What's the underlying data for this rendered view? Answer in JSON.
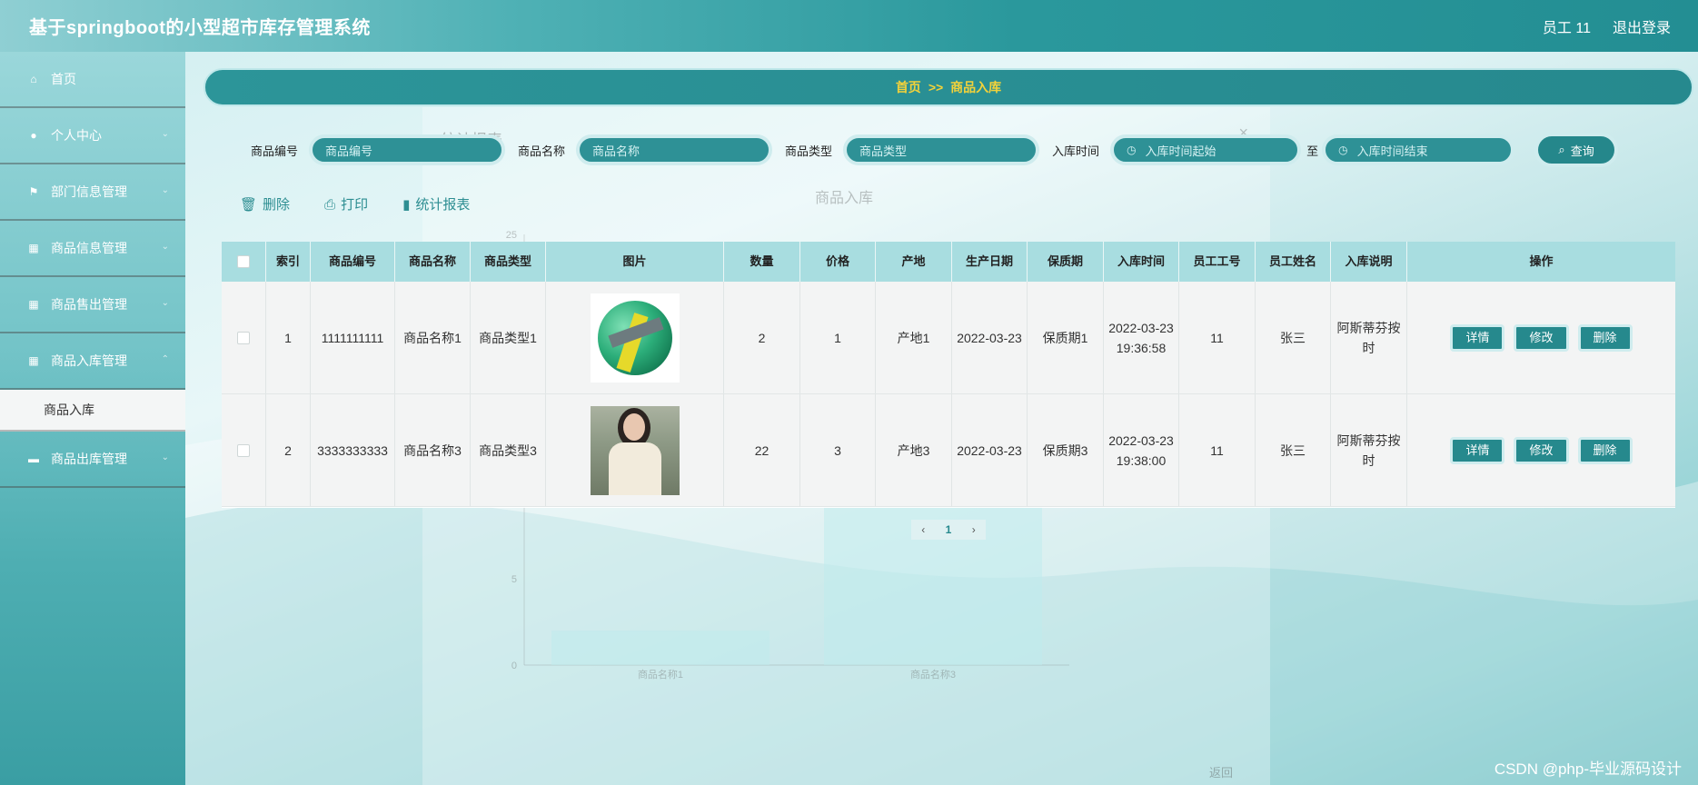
{
  "header": {
    "title": "基于springboot的小型超市库存管理系统",
    "user": "员工 11",
    "logout": "退出登录"
  },
  "sidebar": {
    "items": [
      {
        "label": "首页",
        "icon": "home-icon"
      },
      {
        "label": "个人中心",
        "icon": "user-icon"
      },
      {
        "label": "部门信息管理",
        "icon": "flag-icon"
      },
      {
        "label": "商品信息管理",
        "icon": "grid-icon"
      },
      {
        "label": "商品售出管理",
        "icon": "grid-icon"
      },
      {
        "label": "商品入库管理",
        "icon": "grid-icon"
      },
      {
        "label": "商品出库管理",
        "icon": "monitor-icon"
      }
    ],
    "sub_item": "商品入库"
  },
  "breadcrumb": {
    "home": "首页",
    "sep": ">>",
    "current": "商品入库"
  },
  "search": {
    "code_label": "商品编号",
    "code_placeholder": "商品编号",
    "name_label": "商品名称",
    "name_placeholder": "商品名称",
    "type_label": "商品类型",
    "type_placeholder": "商品类型",
    "time_label": "入库时间",
    "time_start": "入库时间起始",
    "to": "至",
    "time_end": "入库时间结束",
    "query": "查询"
  },
  "toolbar": {
    "delete": "删除",
    "print": "打印",
    "report": "统计报表"
  },
  "modal": {
    "title": "统计报表",
    "chart_title": "商品入库",
    "back": "返回"
  },
  "table": {
    "headers": [
      "索引",
      "商品编号",
      "商品名称",
      "商品类型",
      "图片",
      "数量",
      "价格",
      "产地",
      "生产日期",
      "保质期",
      "入库时间",
      "员工工号",
      "员工姓名",
      "入库说明",
      "操作"
    ],
    "rows": [
      {
        "index": "1",
        "code": "1111111111",
        "name": "商品名称1",
        "type": "商品类型1",
        "qty": "2",
        "price": "1",
        "origin": "产地1",
        "date": "2022-03-23",
        "shelf": "保质期1",
        "time": "2022-03-23 19:36:58",
        "emp_no": "11",
        "emp_name": "张三",
        "note": "阿斯蒂芬按时"
      },
      {
        "index": "2",
        "code": "3333333333",
        "name": "商品名称3",
        "type": "商品类型3",
        "qty": "22",
        "price": "3",
        "origin": "产地3",
        "date": "2022-03-23",
        "shelf": "保质期3",
        "time": "2022-03-23 19:38:00",
        "emp_no": "11",
        "emp_name": "张三",
        "note": "阿斯蒂芬按时"
      }
    ],
    "actions": {
      "detail": "详情",
      "edit": "修改",
      "delete": "删除"
    }
  },
  "pager": {
    "page": "1"
  },
  "chart_data": {
    "type": "bar",
    "title": "商品入库",
    "categories": [
      "商品名称1",
      "商品名称3"
    ],
    "values": [
      2,
      22
    ],
    "ylim": [
      0,
      25
    ],
    "yticks": [
      "0",
      "5",
      "10",
      "15",
      "20",
      "25"
    ]
  },
  "watermark": "CSDN @php-毕业源码设计"
}
